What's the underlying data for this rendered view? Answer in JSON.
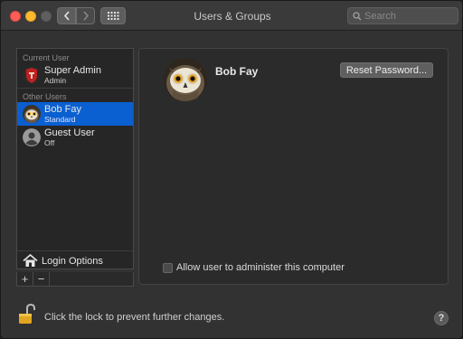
{
  "window": {
    "title": "Users & Groups"
  },
  "toolbar": {
    "search_placeholder": "Search"
  },
  "sidebar": {
    "current_user_label": "Current User",
    "other_users_label": "Other Users",
    "users": [
      {
        "name": "Super Admin",
        "role": "Admin",
        "selected": false,
        "avatar_icon": "admin-avatar-icon"
      },
      {
        "name": "Bob Fay",
        "role": "Standard",
        "selected": true,
        "avatar_icon": "owl-avatar-icon"
      },
      {
        "name": "Guest User",
        "role": "Off",
        "selected": false,
        "avatar_icon": "guest-avatar-icon"
      }
    ],
    "login_options_label": "Login Options",
    "add_label": "+",
    "remove_label": "−"
  },
  "detail": {
    "user_name": "Bob Fay",
    "reset_password_label": "Reset Password...",
    "allow_admin_label": "Allow user to administer this computer",
    "allow_admin_checked": false
  },
  "footer": {
    "lock_text": "Click the lock to prevent further changes.",
    "help_label": "?"
  },
  "colors": {
    "selection": "#0a5fd1",
    "window_bg": "#323232",
    "close": "#fd5f57",
    "minimize": "#febb2e"
  }
}
